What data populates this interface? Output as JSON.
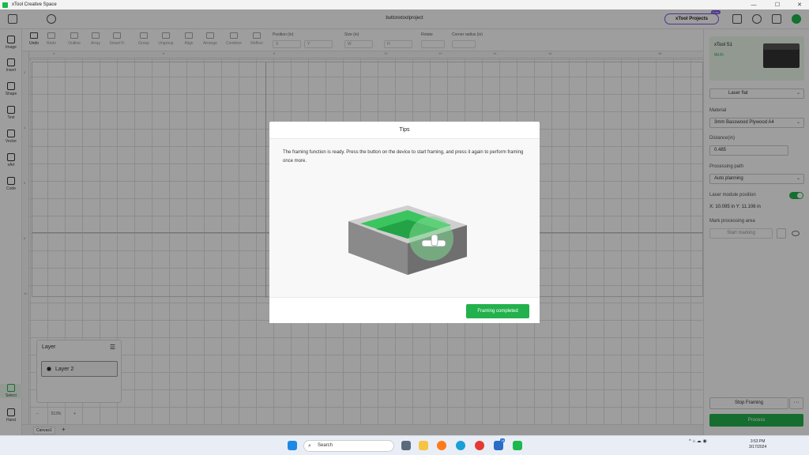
{
  "window": {
    "title": "xTool Creative Space",
    "minimize": "—",
    "maximize": "☐",
    "close": "✕"
  },
  "topbar": {
    "project_name": "buttonxtoolproject",
    "xtool_projects": "xTool Projects",
    "free_badge": "Free"
  },
  "toolbar": {
    "undo": "Undo",
    "redo": "Redo",
    "outline": "Outline",
    "array": "Array",
    "smart_fill": "Smart Fi",
    "group": "Group",
    "ungroup": "Ungroup",
    "align": "Align",
    "arrange": "Arrange",
    "combine": "Combine",
    "reflect": "Reflect",
    "position_label": "Position (in)",
    "x_placeholder": "X",
    "y_placeholder": "Y",
    "size_label": "Size (in)",
    "w_placeholder": "W",
    "h_placeholder": "H",
    "rotate_label": "Rotate",
    "corner_label": "Corner radius (in)"
  },
  "left_sidebar": {
    "image": "Image",
    "insert": "Insert",
    "shape": "Shape",
    "text": "Text",
    "vector": "Vector",
    "xart": "xArt",
    "code": "Code",
    "select": "Select",
    "hand": "Hand"
  },
  "rulers": {
    "top": [
      "4",
      "6",
      "8",
      "10",
      "12",
      "14",
      "16",
      "18"
    ],
    "left": [
      "2",
      "4",
      "6",
      "8",
      "10"
    ]
  },
  "layer_panel": {
    "title": "Layer",
    "menu_icon": "☰",
    "layer_name": "Layer 2"
  },
  "zoom": {
    "minus": "−",
    "value": "513%",
    "plus": "+"
  },
  "canvas_tabs": {
    "tab": "Canvas1",
    "add": "+"
  },
  "right_panel": {
    "device_name": "xTool S1",
    "device_status": "Wi-Fi",
    "mode": "Laser flat",
    "material_label": "Material",
    "material_value": "3mm Basswood Plywood A4",
    "distance_label": "Distance(in)",
    "distance_value": "0.485",
    "processing_path_label": "Processing path",
    "processing_path_value": "Auto planning",
    "laser_module_label": "Laser module position",
    "laser_module_on": true,
    "coords": "X: 10.095 in   Y: 11.106 in",
    "mark_area_label": "Mark processing area",
    "start_marking": "Start marking",
    "stop_framing": "Stop Framing",
    "more": "···",
    "process": "Process"
  },
  "modal": {
    "title": "Tips",
    "message": "The framing function is ready. Press the button on the device to start framing, and press it again to perform framing once more.",
    "button": "Framing completed"
  },
  "taskbar": {
    "search_placeholder": "Search",
    "badge_count": "14",
    "time": "3:53 PM",
    "date": "3/17/2024",
    "tray_icons": "^   ⌂  ☁  ◉"
  },
  "colors": {
    "accent": "#22b14c",
    "brand_purple": "#7c55e0",
    "overlay": "rgba(0,0,0,0.38)"
  }
}
